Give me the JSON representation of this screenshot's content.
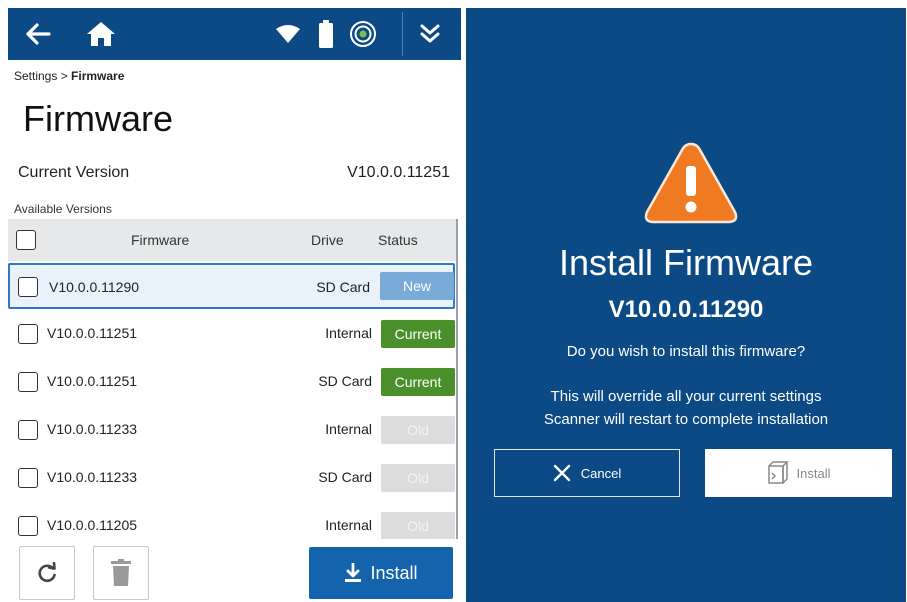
{
  "topbar": {
    "icons": [
      "back-arrow-icon",
      "home-icon",
      "wifi-icon",
      "battery-icon",
      "target-icon",
      "double-chevron-down-icon"
    ]
  },
  "breadcrumb": {
    "parent": "Settings",
    "separator": " > ",
    "current": "Firmware"
  },
  "page_title": "Firmware",
  "current_version": {
    "label": "Current Version",
    "value": "V10.0.0.11251"
  },
  "available_label": "Available Versions",
  "table": {
    "headers": {
      "firmware": "Firmware",
      "drive": "Drive",
      "status": "Status"
    },
    "rows": [
      {
        "firmware": "V10.0.0.11290",
        "drive": "SD Card",
        "status": "New",
        "kind": "new",
        "selected": true
      },
      {
        "firmware": "V10.0.0.11251",
        "drive": "Internal",
        "status": "Current",
        "kind": "current",
        "selected": false
      },
      {
        "firmware": "V10.0.0.11251",
        "drive": "SD Card",
        "status": "Current",
        "kind": "current",
        "selected": false
      },
      {
        "firmware": "V10.0.0.11233",
        "drive": "Internal",
        "status": "Old",
        "kind": "old",
        "selected": false
      },
      {
        "firmware": "V10.0.0.11233",
        "drive": "SD Card",
        "status": "Old",
        "kind": "old",
        "selected": false
      },
      {
        "firmware": "V10.0.0.11205",
        "drive": "Internal",
        "status": "Old",
        "kind": "old",
        "selected": false
      }
    ]
  },
  "footer": {
    "install_label": "Install"
  },
  "dialog": {
    "title": "Install Firmware",
    "version": "V10.0.0.11290",
    "question": "Do you wish to install this firmware?",
    "message_line1": "This will override all your current settings",
    "message_line2": "Scanner will restart to complete installation",
    "cancel_label": "Cancel",
    "install_label": "Install"
  },
  "colors": {
    "brand_blue": "#0c4a86",
    "button_blue": "#1364ad",
    "status_new": "#7aaad8",
    "status_current": "#4a8f2a",
    "status_old": "#dcdcdc",
    "warning_orange": "#f07a22"
  }
}
